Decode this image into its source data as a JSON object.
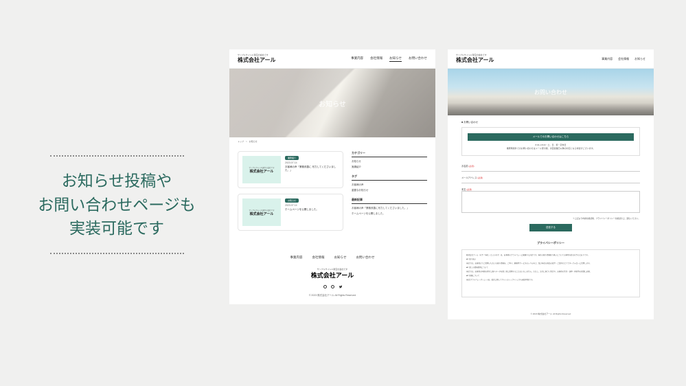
{
  "feature": {
    "line1": "お知らせ投稿や",
    "line2": "お問い合わせページも",
    "line3": "実装可能です"
  },
  "shared": {
    "tagline": "サンプルサイトA 架空の会社です",
    "company_prefix": "株式会社",
    "company_name": "アール"
  },
  "news_page": {
    "nav": [
      "事業内容",
      "会社情報",
      "お知らせ",
      "お問い合わせ"
    ],
    "active_nav_index": 2,
    "hero_title": "お知らせ",
    "breadcrumb": "トップ　>　お知らせ",
    "posts": [
      {
        "badge": "業務紹介",
        "date": "2023.07.14",
        "excerpt": "お客様の声「業務改善に 尽力してくださいました。」"
      },
      {
        "badge": "お知らせ",
        "date": "2023.07.14",
        "excerpt": "ホームページを公開しました。"
      }
    ],
    "sidebar": {
      "category_h": "カテゴリー",
      "categories": [
        "お知らせ",
        "実績紹介"
      ],
      "tag_h": "タグ",
      "tags": [
        "お客様の声",
        "重要なお知らせ"
      ],
      "recent_h": "最新記事",
      "recent": [
        "お客様の声「業務改善に尽力してくださいました。」",
        "ホームページを公開しました。"
      ]
    },
    "footer_nav": [
      "事業内容",
      "会社情報",
      "お知らせ",
      "お問い合わせ"
    ],
    "copyright": "© 2023 株式会社アール All Rights Reserved"
  },
  "contact_page": {
    "nav": [
      "事業内容",
      "会社情報",
      "お知らせ"
    ],
    "hero_title": "お問い合わせ",
    "section_label": "■ お問い合わせ",
    "mail_banner": "メールでのお問い合わせはこちら",
    "mail_desc1": "8:30~18:00・土、日、祝・定休日",
    "mail_desc2": "推薦時間外でのお問い合わせはメール受付後、次回営業日以降の対応となる場合がございます。",
    "form": {
      "name_label": "お名前",
      "email_label": "メールアドレス",
      "body_label": "本文",
      "required": "(必須)",
      "note": "※上記より内容を確認後、プライバシーポリシーを確認の上、送信ください。",
      "submit": "送信する"
    },
    "privacy_h": "プライバシーポリシー",
    "privacy_body": [
      "株式会社アール（以下「当社」といいます）は、お客様のプライバシーに配慮する方針です。当社の個人情報取り扱いについての基本方針は以下のとおりです。",
      "■1. 取り扱い",
      "当社では、お客様よりご提供いただいた個人情報を、ご本人、顧客等サービスのレベル向上、及び当社の商品の紹介・ご案内などアフターフォローに活用します。",
      "■2. 第三の情報提供について",
      "当社では、お客様の同意を得ずに個人データを第三者に提供することはいたしません。ただし、法令に基づく場合や、お客様の生命・身体・財産等の保護に必要、",
      "■3. 管理について",
      "当社(プライバシーポリシー)は、改定に際してサイトのトップページから確認可能です。"
    ],
    "copyright": "© 2023 株式会社アール All Rights Reserved"
  }
}
